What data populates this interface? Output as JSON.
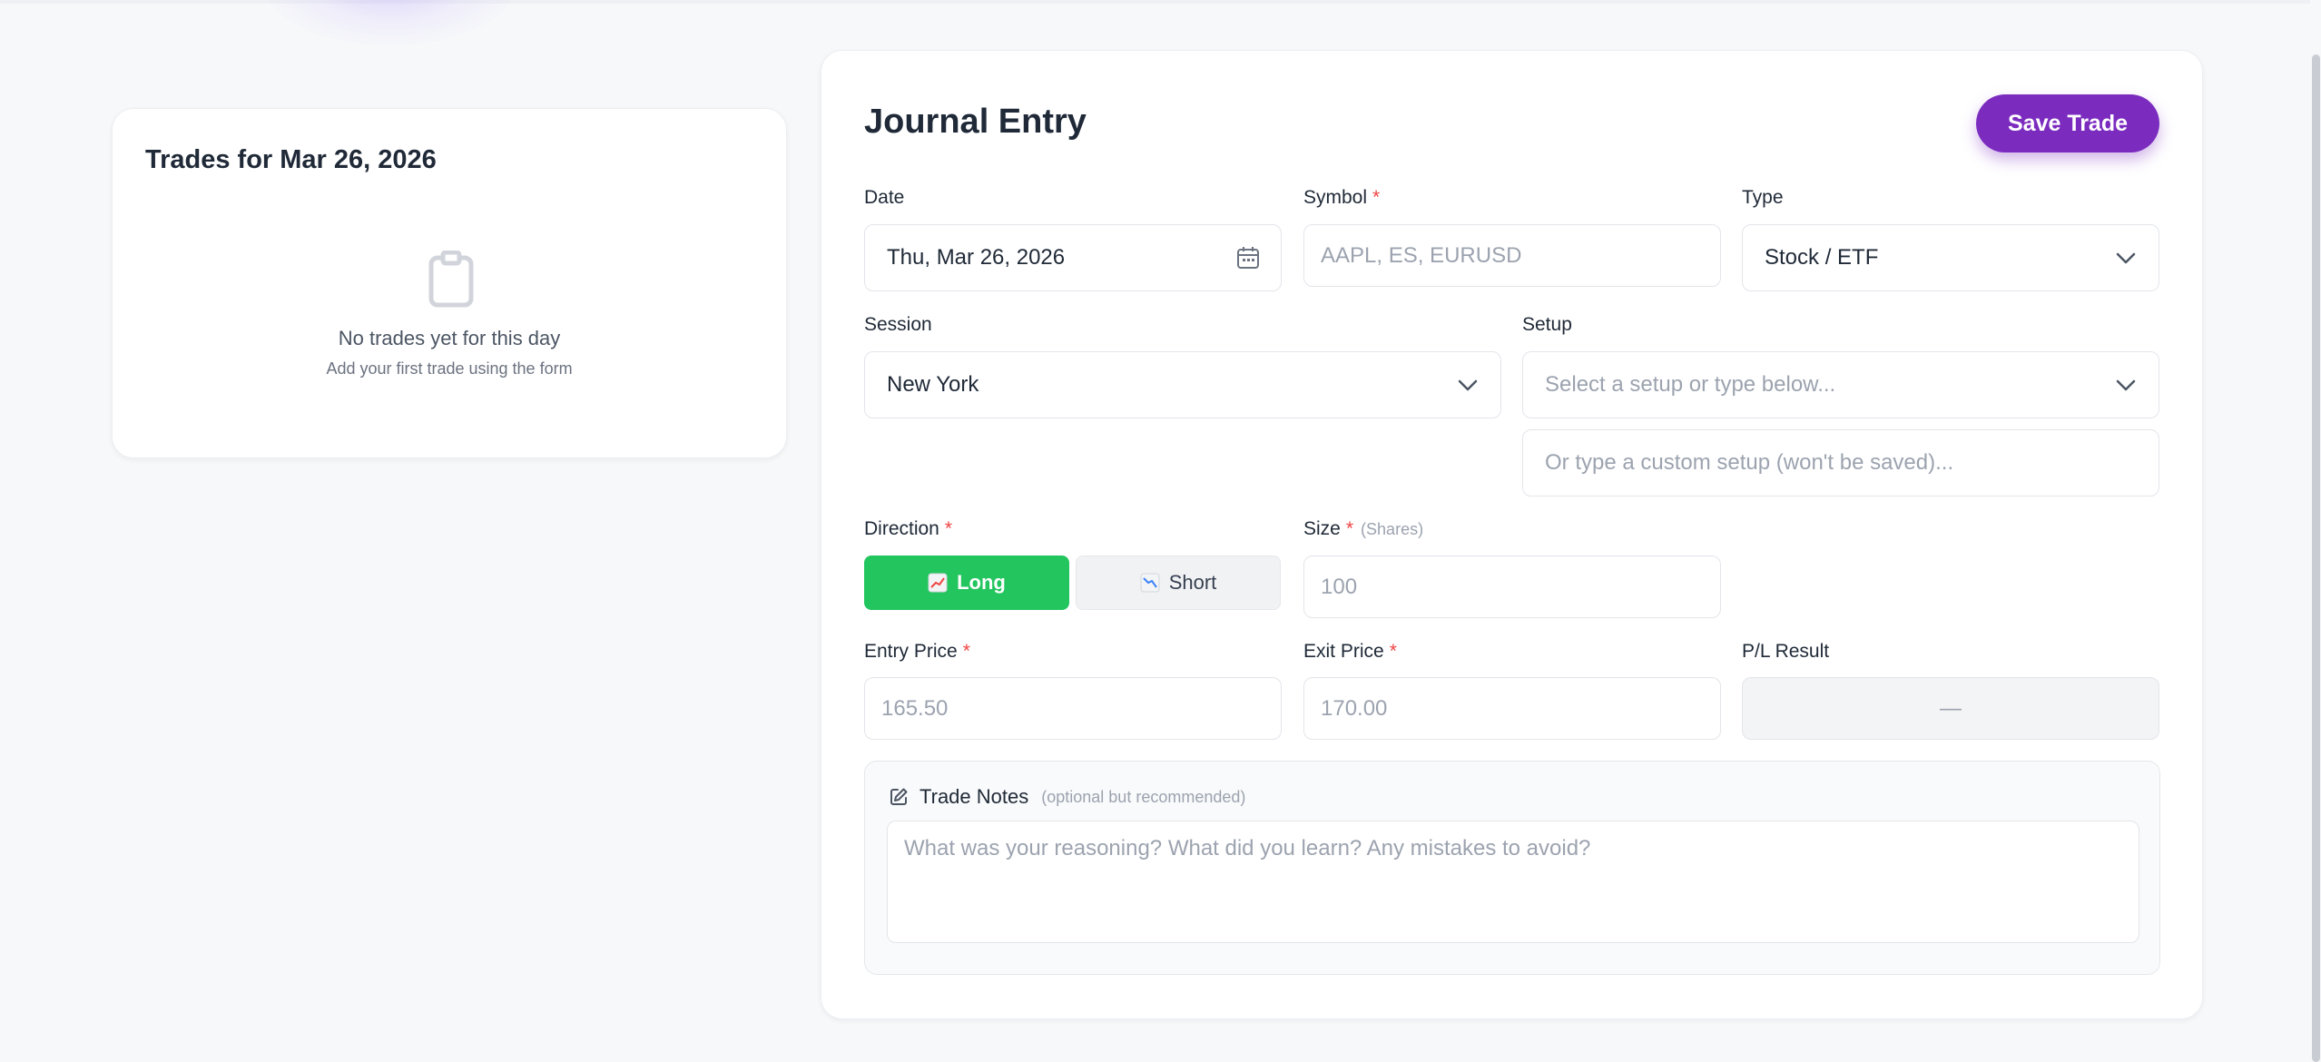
{
  "colors": {
    "accent": "#7b2cbf",
    "long_active": "#22c55e",
    "required": "#ef4444"
  },
  "day_panel": {
    "title": "Trades for Mar 26, 2026",
    "empty_icon": "clipboard-icon",
    "empty_title": "No trades yet for this day",
    "empty_subtitle": "Add your first trade using the form"
  },
  "journal": {
    "title": "Journal Entry",
    "save_label": "Save Trade",
    "required_mark": "*",
    "date": {
      "label": "Date",
      "value": "Thu, Mar 26, 2026",
      "icon": "calendar-icon"
    },
    "symbol": {
      "label": "Symbol",
      "placeholder": "AAPL, ES, EURUSD"
    },
    "type": {
      "label": "Type",
      "value": "Stock / ETF",
      "icon": "chevron-down-icon"
    },
    "session": {
      "label": "Session",
      "value": "New York",
      "icon": "chevron-down-icon"
    },
    "setup": {
      "label": "Setup",
      "select_placeholder": "Select a setup or type below...",
      "custom_placeholder": "Or type a custom setup (won't be saved)..."
    },
    "direction": {
      "label": "Direction",
      "long_label": "Long",
      "short_label": "Short",
      "selected": "Long",
      "long_icon": "chart-up-icon",
      "short_icon": "chart-down-icon"
    },
    "size": {
      "label": "Size",
      "unit_hint": "(Shares)",
      "placeholder": "100"
    },
    "entry_price": {
      "label": "Entry Price",
      "placeholder": "165.50"
    },
    "exit_price": {
      "label": "Exit Price",
      "placeholder": "170.00"
    },
    "pl_result": {
      "label": "P/L Result",
      "value": "—"
    },
    "notes": {
      "icon": "edit-icon",
      "label": "Trade Notes",
      "hint": "(optional but recommended)",
      "placeholder": "What was your reasoning? What did you learn? Any mistakes to avoid?"
    }
  }
}
